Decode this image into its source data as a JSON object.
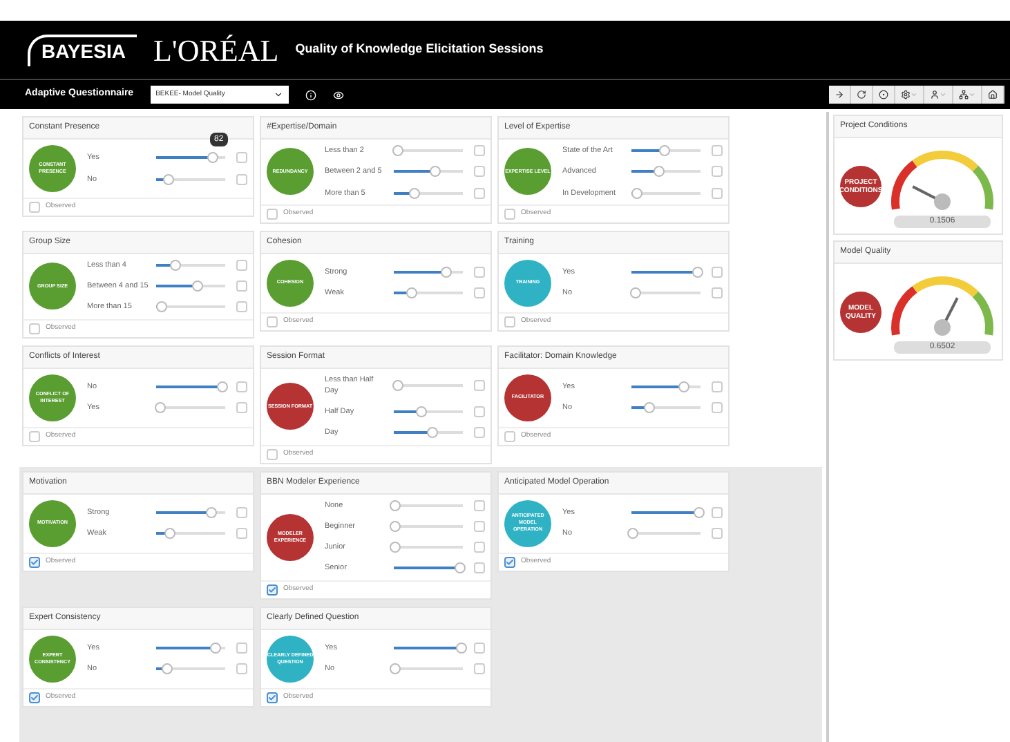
{
  "header": {
    "brand": "BAYESIA",
    "client": "L'ORÉAL",
    "title": "Quality of Knowledge Elicitation Sessions"
  },
  "toolbar": {
    "title": "Adaptive Questionnaire",
    "dropdown": "BEKEE- Model Quality"
  },
  "rows": [
    [
      {
        "title": "Constant Presence",
        "badge": "CONSTANT PRESENCE",
        "color": "#5a9e32",
        "observed": false,
        "observed_label": "Observed",
        "states": [
          {
            "label": "Yes",
            "level": 0.82,
            "checked": false,
            "tooltip": "82"
          },
          {
            "label": "No",
            "level": 0.18,
            "checked": false
          }
        ]
      },
      {
        "title": "#Expertise/Domain",
        "badge": "REDUNDANCY",
        "color": "#5a9e32",
        "observed": false,
        "observed_label": "Observed",
        "states": [
          {
            "label": "Less than 2",
            "level": 0.05,
            "checked": false
          },
          {
            "label": "Between 2 and 5",
            "level": 0.6,
            "checked": false
          },
          {
            "label": "More than 5",
            "level": 0.3,
            "checked": false
          }
        ]
      },
      {
        "title": "Level of Expertise",
        "badge": "EXPERTISE LEVEL",
        "color": "#5a9e32",
        "observed": false,
        "observed_label": "Observed",
        "states": [
          {
            "label": "State of the Art",
            "level": 0.48,
            "checked": false
          },
          {
            "label": "Advanced",
            "level": 0.4,
            "checked": false
          },
          {
            "label": "In Development",
            "level": 0.08,
            "checked": false
          }
        ]
      }
    ],
    [
      {
        "title": "Group Size",
        "badge": "GROUP SIZE",
        "color": "#5a9e32",
        "observed": false,
        "observed_label": "Observed",
        "states": [
          {
            "label": "Less than 4",
            "level": 0.28,
            "checked": false
          },
          {
            "label": "Between 4 and 15",
            "level": 0.6,
            "checked": false
          },
          {
            "label": "More than 15",
            "level": 0.08,
            "checked": false
          }
        ]
      },
      {
        "title": "Cohesion",
        "badge": "COHESION",
        "color": "#5a9e32",
        "observed": false,
        "observed_label": "Observed",
        "states": [
          {
            "label": "Strong",
            "level": 0.75,
            "checked": false
          },
          {
            "label": "Weak",
            "level": 0.25,
            "checked": false
          }
        ]
      },
      {
        "title": "Training",
        "badge": "TRAINING",
        "color": "#2fb3c4",
        "observed": false,
        "observed_label": "Observed",
        "states": [
          {
            "label": "Yes",
            "level": 0.95,
            "checked": false
          },
          {
            "label": "No",
            "level": 0.05,
            "checked": false
          }
        ]
      }
    ],
    [
      {
        "title": "Conflicts of Interest",
        "badge": "CONFLICT OF INTEREST",
        "color": "#5a9e32",
        "observed": false,
        "observed_label": "Observed",
        "states": [
          {
            "label": "No",
            "level": 0.95,
            "checked": false
          },
          {
            "label": "Yes",
            "level": 0.05,
            "checked": false
          }
        ]
      },
      {
        "title": "Session Format",
        "badge": "SESSION FORMAT",
        "color": "#b53333",
        "observed": false,
        "observed_label": "Observed",
        "states": [
          {
            "label": "Less than Half Day",
            "level": 0.05,
            "checked": false
          },
          {
            "label": "Half Day",
            "level": 0.4,
            "checked": false
          },
          {
            "label": "Day",
            "level": 0.55,
            "checked": false
          }
        ]
      },
      {
        "title": "Facilitator: Domain Knowledge",
        "badge": "FACILITATOR",
        "color": "#b53333",
        "observed": false,
        "observed_label": "Observed",
        "states": [
          {
            "label": "Yes",
            "level": 0.75,
            "checked": false
          },
          {
            "label": "No",
            "level": 0.25,
            "checked": false
          }
        ]
      }
    ],
    [
      {
        "title": "Motivation",
        "badge": "MOTIVATION",
        "color": "#5a9e32",
        "observed": true,
        "observed_label": "Observed",
        "states": [
          {
            "label": "Strong",
            "level": 0.8,
            "checked": false
          },
          {
            "label": "Weak",
            "level": 0.2,
            "checked": false
          }
        ]
      },
      {
        "title": "BBN Modeler Experience",
        "badge": "MODELER EXPERIENCE",
        "color": "#b53333",
        "observed": true,
        "observed_label": "Observed",
        "states": [
          {
            "label": "None",
            "level": 0.02,
            "checked": false
          },
          {
            "label": "Beginner",
            "level": 0.02,
            "checked": false
          },
          {
            "label": "Junior",
            "level": 0.02,
            "checked": false
          },
          {
            "label": "Senior",
            "level": 0.96,
            "checked": false
          }
        ]
      },
      {
        "title": "Anticipated Model Operation",
        "badge": "ANTICIPATED MODEL OPERATION",
        "color": "#2fb3c4",
        "observed": true,
        "observed_label": "Observed",
        "states": [
          {
            "label": "Yes",
            "level": 0.98,
            "checked": false
          },
          {
            "label": "No",
            "level": 0.02,
            "checked": false
          }
        ]
      }
    ],
    [
      {
        "title": "Expert Consistency",
        "badge": "EXPERT CONSISTENCY",
        "color": "#5a9e32",
        "observed": true,
        "observed_label": "Observed",
        "states": [
          {
            "label": "Yes",
            "level": 0.85,
            "checked": false
          },
          {
            "label": "No",
            "level": 0.15,
            "checked": false
          }
        ]
      },
      {
        "title": "Clearly Defined Question",
        "badge": "CLEARLY DEFINED QUESTION",
        "color": "#2fb3c4",
        "observed": true,
        "observed_label": "Observed",
        "states": [
          {
            "label": "Yes",
            "level": 0.98,
            "checked": false
          },
          {
            "label": "No",
            "level": 0.02,
            "checked": false
          }
        ]
      }
    ]
  ],
  "gauges": [
    {
      "title": "Project Conditions",
      "badge": "PROJECT CONDITIONS",
      "reading": "0.1506"
    },
    {
      "title": "Model Quality",
      "badge": "MODEL QUALITY",
      "reading": "0.6502"
    }
  ]
}
